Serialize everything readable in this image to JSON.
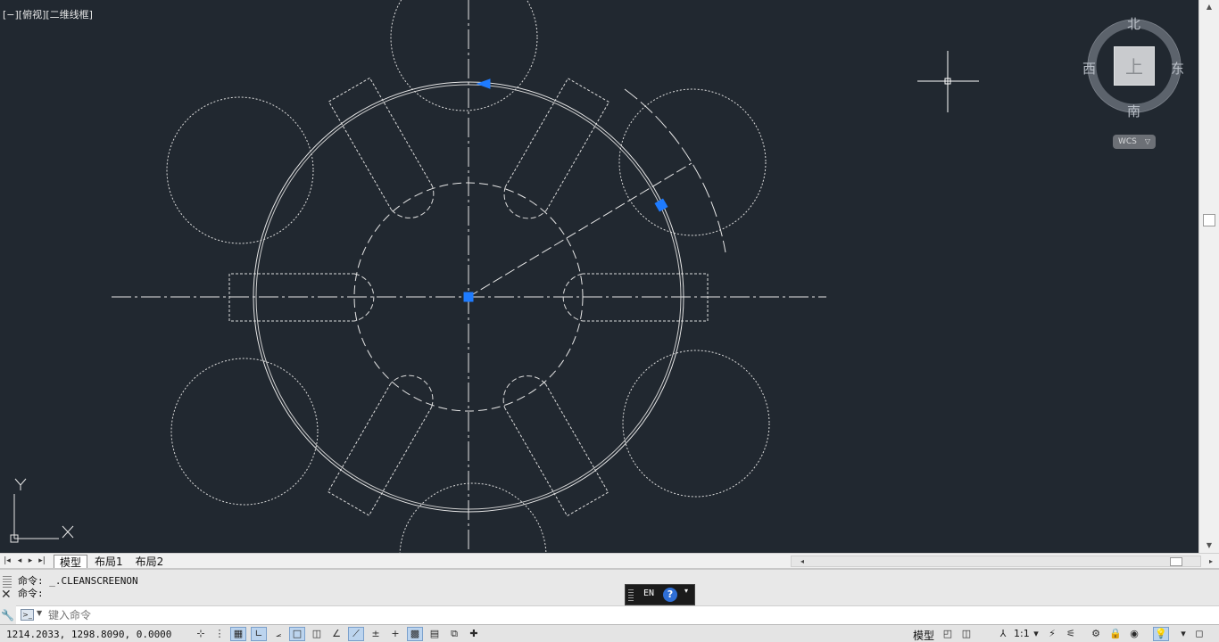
{
  "viewport": {
    "label": "[−][俯视][二维线框]"
  },
  "viewcube": {
    "north": "北",
    "south": "南",
    "west": "西",
    "east": "东",
    "top_face": "上",
    "wcs_label": "WCS",
    "wcs_arrow": "▽"
  },
  "ucs": {
    "x_label": "X",
    "y_label": "Y"
  },
  "tabs": {
    "nav": [
      "first-icon",
      "prev-icon",
      "next-icon",
      "last-icon"
    ],
    "items": [
      {
        "label": "模型",
        "active": true
      },
      {
        "label": "布局1",
        "active": false
      },
      {
        "label": "布局2",
        "active": false
      }
    ]
  },
  "command": {
    "history": [
      "命令: _.CLEANSCREENON",
      "命令:"
    ],
    "input_placeholder": "键入命令"
  },
  "langbar": {
    "code": "EN",
    "help": "?"
  },
  "statusbar": {
    "coords": "1214.2033, 1298.8090, 0.0000",
    "model_label": "模型",
    "scale_label": "1:1"
  },
  "colors": {
    "background": "#212830",
    "grip": "#1e7bff",
    "line": "#e6e6e6"
  }
}
